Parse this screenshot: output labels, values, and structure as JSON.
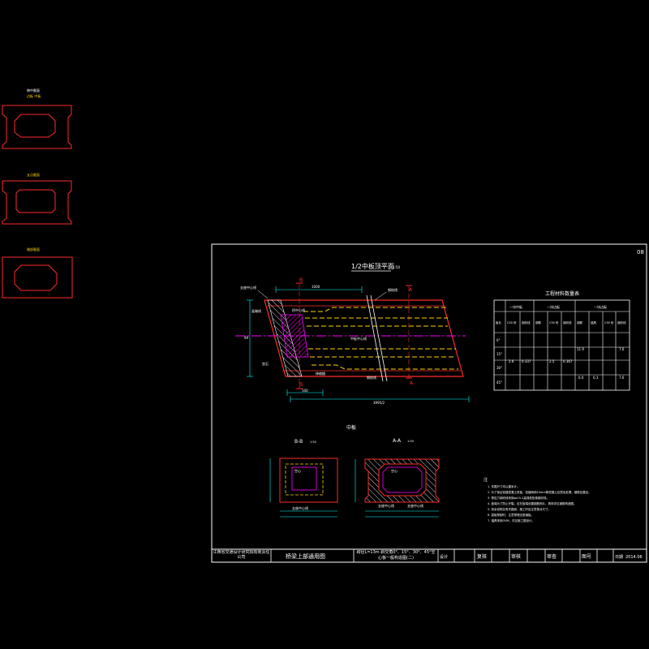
{
  "colors": {
    "background": "#000000",
    "frame": "#ffffff",
    "section_outline": "#ff2a2a",
    "rebar_yellow": "#ffd400",
    "centerline_magenta": "#ff00ff",
    "hatch_magenta": "#ff00ff",
    "dimension_cyan": "#00ffff",
    "text_white": "#ffffff"
  },
  "side_sections": {
    "label_1a": "跨中截面",
    "label_1b": "边板 中板",
    "label_2": "支点截面",
    "label_3": "端部截面"
  },
  "sheet": {
    "sheet_number": "08",
    "plan_title": "1/2中板顶平面",
    "plan_scale": "1:50",
    "section_marker_b": "B",
    "section_marker_a": "A",
    "plan_labels": {
      "left_top": "支座中心线",
      "left_mid": "梁端线",
      "left_dim": "垫石",
      "mid_left": "桥中心线",
      "top_right": "钢绞线",
      "center": "中板中心线",
      "bottom_right": "钢绞线",
      "bottom_left": "伸缩缝",
      "dim_bottom_1": "100",
      "dim_bottom_2": "3995/2",
      "dim_top": "1000",
      "dim_left": "99"
    },
    "midspan_label": "中板",
    "section_bb_title": "B-B",
    "section_bb_scale": "1:50",
    "section_aa_title": "A-A",
    "section_aa_scale": "1:50",
    "section_labels": {
      "bb_core": "空心",
      "bb_bottom": "支座中心线",
      "aa_core": "空心",
      "aa_bottom_left": "支座中心线",
      "aa_bottom_right": "支座中心线"
    },
    "table": {
      "title": "工程材料数量表",
      "col_groups": [
        "一块中板",
        "一块边板",
        "一块边板"
      ],
      "headers": [
        "板长",
        "C50 砼",
        "钢绞线",
        "钢筋",
        "C50 砼",
        "钢绞线",
        "钢筋",
        "锚具",
        "C50 砼",
        "钢绞线",
        "钢筋"
      ],
      "rows": [
        [
          "0°",
          "",
          "",
          "",
          "",
          "",
          "",
          "",
          "",
          "",
          "7.6"
        ],
        [
          "15°",
          "",
          "",
          "",
          "",
          "",
          "",
          "",
          "",
          "",
          ""
        ],
        [
          "30°",
          "2.6",
          "0.337",
          "",
          "2.5",
          "0.367",
          "11.9",
          "",
          "",
          "",
          ""
        ],
        [
          "45°",
          "",
          "",
          "",
          "",
          "",
          "",
          "",
          "",
          "",
          ""
        ]
      ],
      "note_row": [
        "",
        "",
        "",
        "",
        "",
        "",
        "",
        "",
        "6.0",
        "0.3",
        "7.6"
      ]
    },
    "notes_title": "注",
    "notes": [
      "1. 本图尺寸均以厘米计。",
      "2. 为了保证铰缝混凝土质量，铰缝两侧10mm厚混凝土应凿毛处理，钢筋应露出。",
      "3. 预应力钢绞线采用φs15.2高强低松弛钢绞线。",
      "4. 板端为了防止开裂，应在板端设置钢筋网片，具体详见钢筋构造图。",
      "5. 其余说明见有关图纸，施工时应注意核对尺寸。",
      "6. 梁板预制时，注意预埋支座钢板。",
      "7. 锚具采用OVM，详见施工图设计。"
    ],
    "title_block": {
      "company": "江西省交通设计研究院有限责任公司",
      "project": "桥梁上部通用图",
      "drawing_name": "跨径L=13m 斜交角0°、15°、30°、45°空心板一般构造图(二)",
      "design_label": "设计",
      "review1_label": "复核",
      "review2_label": "审核",
      "approve_label": "审查",
      "drawing_no_label": "图号",
      "date_label": "日期",
      "date_value": "2014.06"
    }
  }
}
